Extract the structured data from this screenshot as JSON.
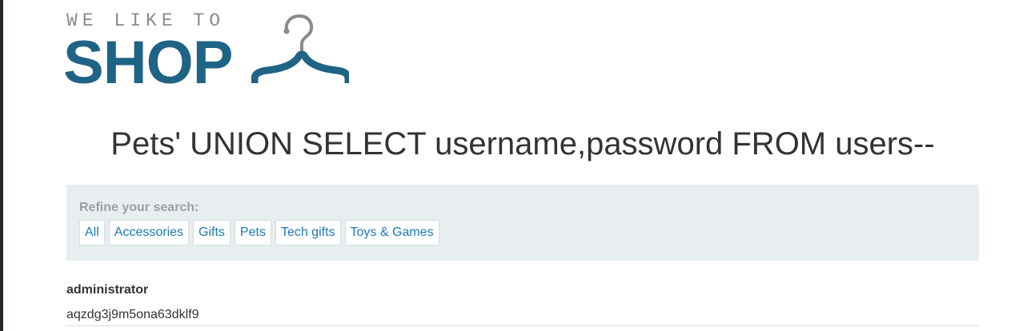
{
  "logo": {
    "tagline": "WE LIKE TO",
    "brand": "SHOP"
  },
  "page": {
    "title": "Pets' UNION SELECT username,password FROM users--"
  },
  "filter": {
    "label": "Refine your search:",
    "categories": [
      {
        "label": "All"
      },
      {
        "label": "Accessories"
      },
      {
        "label": "Gifts"
      },
      {
        "label": "Pets"
      },
      {
        "label": "Tech gifts"
      },
      {
        "label": "Toys & Games"
      }
    ]
  },
  "results": [
    {
      "username": "administrator",
      "password": "aqzdg3j9m5ona63dklf9"
    }
  ],
  "colors": {
    "brand": "#1f6385",
    "link": "#1d7ab8",
    "panel": "#e8edef"
  }
}
